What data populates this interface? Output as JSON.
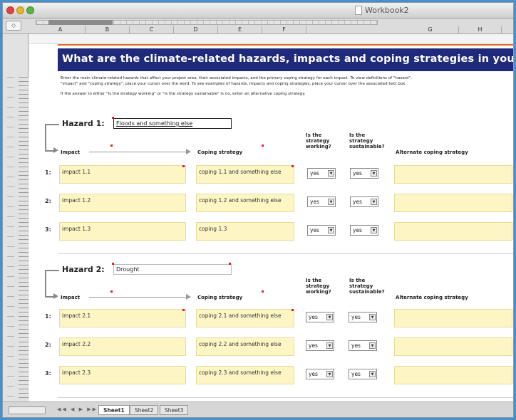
{
  "window": {
    "title": "Workbook2"
  },
  "columns": [
    "A",
    "B",
    "C",
    "D",
    "E",
    "F",
    "G",
    "H"
  ],
  "banner": {
    "title": "What are the climate-related hazards, impacts and coping strategies in your pro"
  },
  "instructions": {
    "line1": "Enter the main climate-related hazards that affect your project area, their associated impacts, and the primary coping strategy for each impact. To view definitions of \"hazard\",",
    "line2": "\"impact\" and \"coping strategy\", place your cursor over the word. To see examples of hazards, impacts and coping strategies, place your cursor over the associated text box.",
    "line3": "If the answer to either \"Is the strategy working\" or \"Is the strategy sustainable\" is no, enter an alternative coping strategy."
  },
  "headers": {
    "impact": "Impact",
    "coping": "Coping strategy",
    "working": [
      "Is the",
      "strategy",
      "working?"
    ],
    "sustainable": [
      "Is the",
      "strategy",
      "sustainable?"
    ],
    "alternate": "Alternate coping strategy"
  },
  "hazards": [
    {
      "label": "Hazard 1:",
      "value": "Floods and something else",
      "rows": [
        {
          "num": "1:",
          "impact": "impact 1.1",
          "coping": "coping 1.1 and something else",
          "working": "yes",
          "sustainable": "yes",
          "alternate": ""
        },
        {
          "num": "2:",
          "impact": "impact 1.2",
          "coping": "coping 1.2 and something else",
          "working": "yes",
          "sustainable": "yes",
          "alternate": ""
        },
        {
          "num": "3:",
          "impact": "impact 1.3",
          "coping": "coping 1.3",
          "working": "yes",
          "sustainable": "yes",
          "alternate": ""
        }
      ]
    },
    {
      "label": "Hazard 2:",
      "value": "Drought",
      "rows": [
        {
          "num": "1:",
          "impact": "impact 2.1",
          "coping": "coping 2.1 and something else",
          "working": "yes",
          "sustainable": "yes",
          "alternate": ""
        },
        {
          "num": "2:",
          "impact": "impact 2.2",
          "coping": "coping 2.2 and something else",
          "working": "yes",
          "sustainable": "yes",
          "alternate": ""
        },
        {
          "num": "3:",
          "impact": "impact 2.3",
          "coping": "coping 2.3 and something else",
          "working": "yes",
          "sustainable": "yes",
          "alternate": ""
        }
      ]
    }
  ],
  "sheet_tabs": [
    "Sheet1",
    "Sheet2",
    "Sheet3"
  ],
  "colors": {
    "banner": "#1f2a7a",
    "cell": "#fdf6c4",
    "accent": "#e06b2d"
  }
}
